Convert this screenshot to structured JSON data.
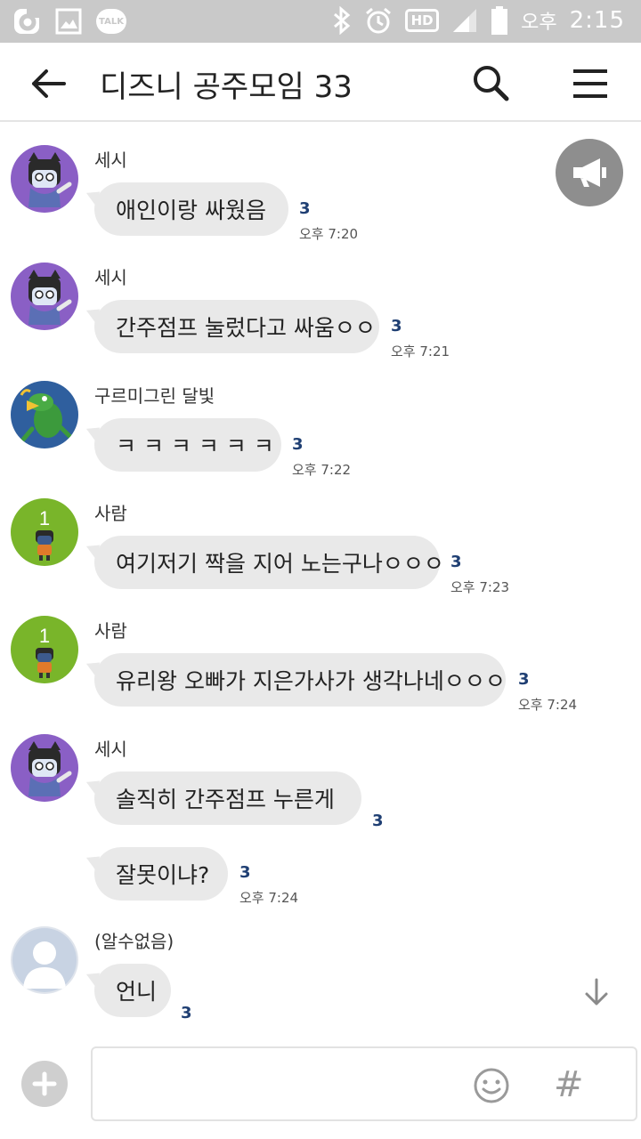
{
  "status_bar": {
    "ampm": "오후",
    "time": "2:15",
    "talk_badge": "TALK",
    "hd_badge": "HD",
    "icons": [
      "carrier-icon",
      "image-icon",
      "talk-icon",
      "bluetooth-icon",
      "alarm-icon",
      "hd-icon",
      "signal-icon",
      "battery-icon"
    ]
  },
  "header": {
    "title": "디즈니 공주모임 33",
    "icons": [
      "back-arrow-icon",
      "search-icon",
      "menu-icon"
    ]
  },
  "colors": {
    "status_bar": "#c9c9c9",
    "bubble": "#e9e9e9",
    "unread": "#1f3f73",
    "avatar_purple": "#8a5fc5",
    "avatar_green": "#79b52a",
    "avatar_blue": "#2f5f9e"
  },
  "messages": [
    {
      "sender": "세시",
      "text": "애인이랑 싸웠음",
      "unread": "3",
      "time": "오후 7:20"
    },
    {
      "sender": "세시",
      "text": "간주점프 눌렀다고 싸움ㅇㅇ",
      "unread": "3",
      "time": "오후 7:21"
    },
    {
      "sender": "구르미그린 달빛",
      "text": "ㅋ ㅋ ㅋ ㅋ ㅋ ㅋ",
      "unread": "3",
      "time": "오후 7:22"
    },
    {
      "sender": "사람",
      "avatar_badge": "1",
      "text": "여기저기 짝을 지어 노는구나ㅇㅇㅇ",
      "unread": "3",
      "time": "오후 7:23"
    },
    {
      "sender": "사람",
      "avatar_badge": "1",
      "text": "유리왕 오빠가 지은가사가 생각나네ㅇㅇㅇ",
      "unread": "3",
      "time": "오후 7:24"
    },
    {
      "sender": "세시",
      "text": "솔직히 간주점프 누른게",
      "unread": "3"
    },
    {
      "text": "잘못이냐?",
      "unread": "3",
      "time": "오후 7:24"
    },
    {
      "sender": "(알수없음)",
      "text": "언니",
      "unread": "3"
    }
  ],
  "input": {
    "placeholder": "",
    "hash_label": "#",
    "icons": [
      "plus-icon",
      "emoji-icon",
      "hash-icon"
    ]
  }
}
